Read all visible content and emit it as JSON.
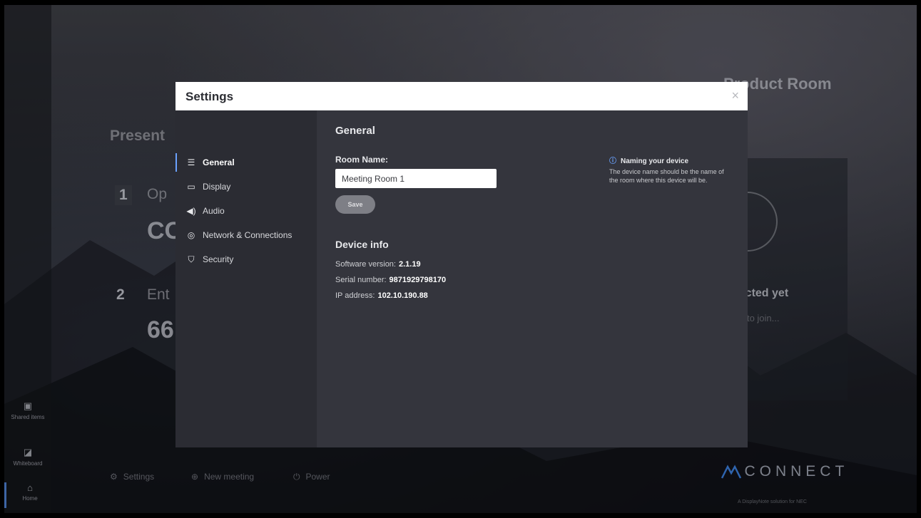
{
  "background": {
    "room_title": "Product Room",
    "present_heading": "Present",
    "step1_number": "1",
    "step1_text": "Op",
    "code_fragment": "CO",
    "step2_number": "2",
    "step2_text": "Ent",
    "pin_fragment": "66",
    "connection_status": "nected yet",
    "invite_text": "ple to join..."
  },
  "rail": {
    "items": [
      {
        "label": "Shared items",
        "icon": "folder-icon"
      },
      {
        "label": "Whiteboard",
        "icon": "whiteboard-icon"
      },
      {
        "label": "Home",
        "icon": "home-icon"
      }
    ]
  },
  "toolbar": {
    "settings_label": "Settings",
    "new_meeting_label": "New meeting",
    "power_label": "Power"
  },
  "brand": {
    "name": "CONNECT",
    "tagline": "A DisplayNote solution for NEC",
    "color": "#3a7bd5"
  },
  "modal": {
    "title": "Settings",
    "close_glyph": "×",
    "nav": [
      {
        "label": "General",
        "icon": "list-icon",
        "glyph": "☰",
        "active": true
      },
      {
        "label": "Display",
        "icon": "monitor-icon",
        "glyph": "▭",
        "active": false
      },
      {
        "label": "Audio",
        "icon": "speaker-icon",
        "glyph": "◀)",
        "active": false
      },
      {
        "label": "Network & Connections",
        "icon": "wifi-icon",
        "glyph": "◎",
        "active": false
      },
      {
        "label": "Security",
        "icon": "shield-icon",
        "glyph": "⛉",
        "active": false
      }
    ],
    "general": {
      "section_title": "General",
      "room_name_label": "Room Name:",
      "room_name_value": "Meeting Room 1",
      "save_label": "Save",
      "device_info_title": "Device info",
      "software_version_label": "Software version:",
      "software_version_value": "2.1.19",
      "serial_number_label": "Serial number:",
      "serial_number_value": "9871929798170",
      "ip_address_label": "IP address:",
      "ip_address_value": "102.10.190.88"
    },
    "help": {
      "title": "Naming your device",
      "body": "The device name should be the name of the room where this device will be."
    }
  },
  "colors": {
    "accent": "#6aa2ff",
    "modal_sidebar": "#2b2c33",
    "modal_main": "#34353d",
    "save_button": "#7e7f86"
  }
}
